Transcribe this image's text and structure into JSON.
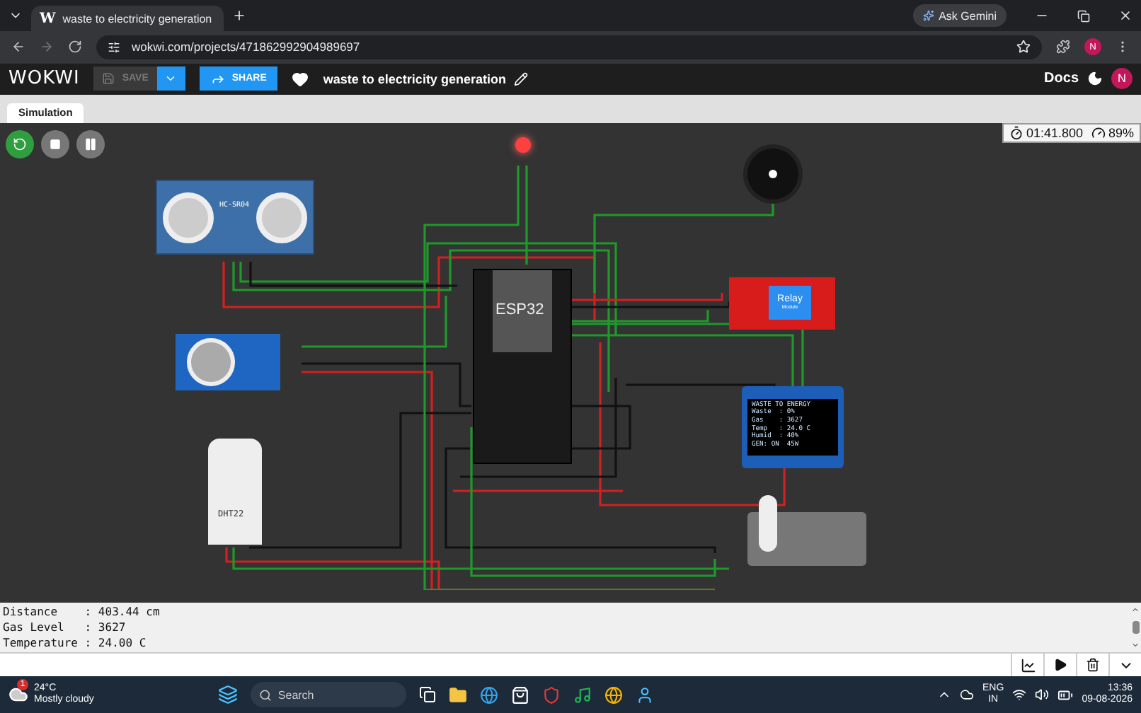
{
  "browser": {
    "favicon": "W",
    "tab_title": "waste to electricity generation",
    "ask_button": "Ask Gemini",
    "url": "wokwi.com/projects/471862992904989697",
    "profile_initial": "N"
  },
  "app_bar": {
    "logo": "WOKWI",
    "save_label": "SAVE",
    "save_disabled": true,
    "share_label": "SHARE",
    "project_title": "waste to electricity generation",
    "docs_label": "Docs",
    "avatar_initial": "N"
  },
  "tabs": [
    {
      "label": "Simulation",
      "selected": true
    }
  ],
  "sim": {
    "running": true,
    "timer": "01:41.800",
    "speed": "89%"
  },
  "parts": {
    "ultrasonic_label": "HC-SR04",
    "esp32_label": "ESP32",
    "relay_label": "Relay",
    "relay_sublabel": "Module",
    "dht_label": "DHT22",
    "led_on": true,
    "oled_lines": [
      "WASTE TO ENERGY",
      "Waste  : 0%",
      "Gas    : 3627",
      "Temp   : 24.0 C",
      "Humid  : 40%",
      "GEN: ON  45W"
    ]
  },
  "serial_lines": [
    "Distance    : 403.44 cm",
    "Gas Level   : 3627",
    "Temperature : 24.00 C"
  ],
  "taskbar": {
    "weather_badge": "1",
    "temperature": "24°C",
    "weather": "Mostly cloudy",
    "search_placeholder": "Search",
    "language": "ENG",
    "region": "IN",
    "time": "13:36",
    "date": "09-08-2026"
  }
}
